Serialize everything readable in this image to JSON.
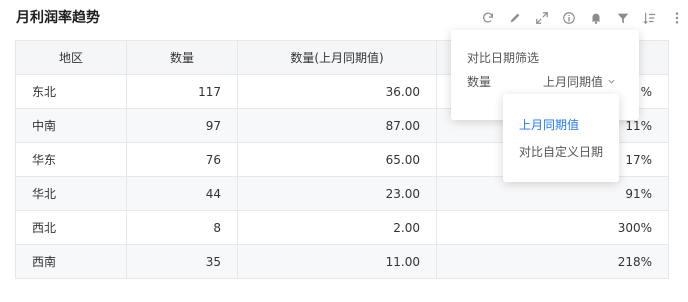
{
  "title": "月利润率趋势",
  "toolbar": {
    "icons": [
      "refresh-icon",
      "edit-icon",
      "expand-icon",
      "info-icon",
      "bell-icon",
      "filter-icon",
      "sort-icon",
      "more-icon"
    ],
    "icon_color": "#8c8c8c"
  },
  "table": {
    "columns": [
      "地区",
      "数量",
      "数量(上月同期值)",
      ""
    ],
    "rows": [
      {
        "region": "东北",
        "qty": "117",
        "prev": "36.00",
        "pct": "%"
      },
      {
        "region": "中南",
        "qty": "97",
        "prev": "87.00",
        "pct": "11%"
      },
      {
        "region": "华东",
        "qty": "76",
        "prev": "65.00",
        "pct": "17%"
      },
      {
        "region": "华北",
        "qty": "44",
        "prev": "23.00",
        "pct": "91%"
      },
      {
        "region": "西北",
        "qty": "8",
        "prev": "2.00",
        "pct": "300%"
      },
      {
        "region": "西南",
        "qty": "35",
        "prev": "11.00",
        "pct": "218%"
      }
    ]
  },
  "compare_popover": {
    "title": "对比日期筛选",
    "label": "数量",
    "selected": "上月同期值"
  },
  "compare_dropdown": {
    "options": [
      "上月同期值",
      "对比自定义日期"
    ],
    "active_color": "#1f78ff"
  }
}
